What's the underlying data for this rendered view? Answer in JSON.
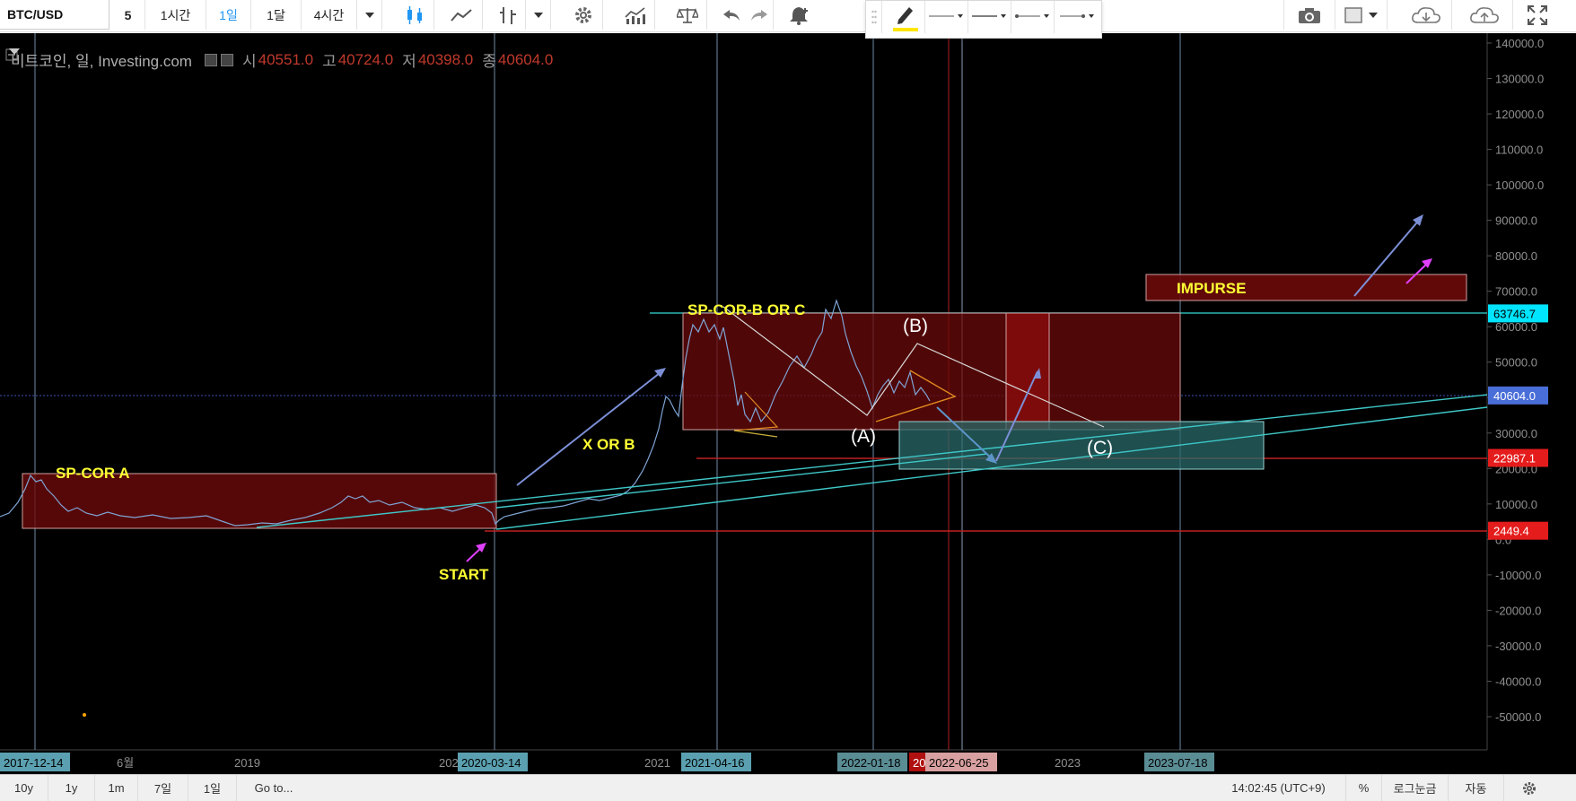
{
  "toolbar": {
    "symbol": "BTC/USD",
    "intervals": [
      "5",
      "1시간",
      "1일",
      "1달",
      "4시간"
    ],
    "active_interval": "1일"
  },
  "legend": {
    "title": "비트코인, 일, Investing.com",
    "open_label": "시",
    "open": "40551.0",
    "high_label": "고",
    "high": "40724.0",
    "low_label": "저",
    "low": "40398.0",
    "close_label": "종",
    "close": "40604.0"
  },
  "price_axis": {
    "ticks": [
      "140000.0",
      "130000.0",
      "120000.0",
      "110000.0",
      "100000.0",
      "90000.0",
      "80000.0",
      "70000.0",
      "60000.0",
      "50000.0",
      "40000.0",
      "30000.0",
      "20000.0",
      "10000.0",
      "0.0",
      "-10000.0",
      "-20000.0",
      "-30000.0",
      "-40000.0",
      "-50000.0"
    ],
    "badges": [
      {
        "value": "63746.7",
        "color": "#00e5ff",
        "text_color": "#000000"
      },
      {
        "value": "40604.0",
        "color": "#4a6ed8",
        "text_color": "#ffffff"
      },
      {
        "value": "22987.1",
        "color": "#e51c1c",
        "text_color": "#ffffff"
      },
      {
        "value": "2449.4",
        "color": "#e51c1c",
        "text_color": "#ffffff"
      }
    ]
  },
  "time_axis": {
    "labels": [
      "6월",
      "2019",
      "202",
      "2021",
      "2023"
    ],
    "badges": [
      "2017-12-14",
      "2020-03-14",
      "2021-04-16",
      "2022-01-18",
      "20",
      "2022-06-25",
      "2023-07-18"
    ]
  },
  "annotations": {
    "sp_cor_a": "SP-COR A",
    "start": "START",
    "x_or_b": "X OR B",
    "sp_cor_b_or_c": "SP-COR-B OR C",
    "wave_a": "(A)",
    "wave_b": "(B)",
    "wave_c": "(C)",
    "impurse": "IMPURSE"
  },
  "bottombar": {
    "ranges": [
      "10y",
      "1y",
      "1m",
      "7일",
      "1일"
    ],
    "goto": "Go to...",
    "clock": "14:02:45 (UTC+9)",
    "percent": "%",
    "log": "로그눈금",
    "auto": "자동"
  },
  "colors": {
    "background": "#000000",
    "zone_fill": "#6b0a0a",
    "teal_zone": "#2a6a6a",
    "annotation_yellow": "#ffff33",
    "arrow_blue": "#7c8fd6",
    "arrow_magenta": "#e040fb",
    "trend_teal": "#3fc7c7"
  }
}
